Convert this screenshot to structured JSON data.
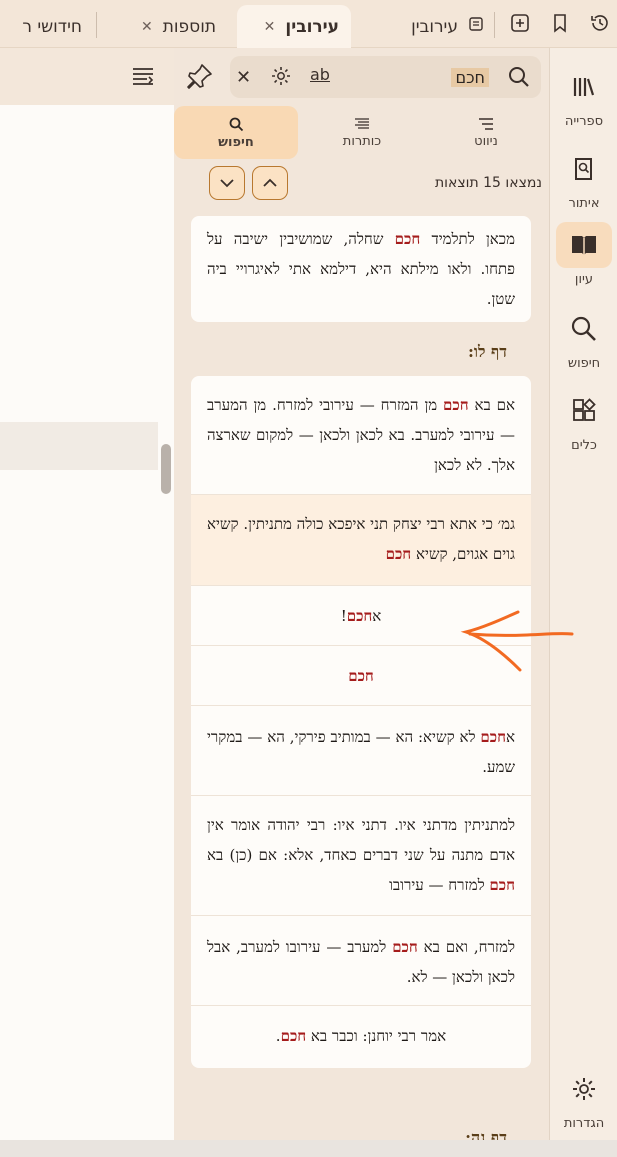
{
  "tabs": [
    {
      "label": "עירובין",
      "active": false,
      "closable": false
    },
    {
      "label": "עירובין",
      "active": true,
      "closable": true
    },
    {
      "label": "תוספות",
      "active": false,
      "closable": true
    },
    {
      "label": "חידושי ר",
      "active": false,
      "closable": true
    }
  ],
  "tab_icons": [
    "history-icon",
    "bookmark-icon",
    "add-tab-icon",
    "book-tab-icon"
  ],
  "rail": {
    "items": [
      {
        "label": "ספרייה",
        "icon": "library-icon"
      },
      {
        "label": "איתור",
        "icon": "locate-icon"
      },
      {
        "label": "עיון",
        "icon": "open-book-icon",
        "active": true
      },
      {
        "label": "חיפוש",
        "icon": "search-icon"
      },
      {
        "label": "כלים",
        "icon": "tools-icon"
      }
    ],
    "settings_label": "הגדרות"
  },
  "search": {
    "query": "חכם",
    "option_label": "ab"
  },
  "mode_tabs": [
    {
      "label": "ניווט",
      "icon": "nav-icon"
    },
    {
      "label": "כותרות",
      "icon": "headings-icon"
    },
    {
      "label": "חיפוש",
      "icon": "search-icon",
      "active": true
    }
  ],
  "results_count": "נמצאו 15 תוצאות",
  "results": {
    "card1": [
      [
        "מכאן לתלמיד ",
        {
          "m": "חכם"
        },
        " שחלה, שמושיבין ישיבה על פתחו. ולאו מילתא היא, דילמא אתי לאיגרויי ביה שטן."
      ]
    ],
    "daf_lu": "דף לו:",
    "card2": [
      [
        "אם בא ",
        {
          "m": "חכם"
        },
        " מן המזרח — עירובי למזרח. מן המערב — עירובי למערב. בא לכאן ולכאן — למקום שארצה אלך. לא לכאן"
      ],
      [
        "גמ׳ כי אתא רבי יצחק תני איפכא כולה מתניתין. קשיא גוים אגוים, קשיא ",
        {
          "m": "חכם"
        }
      ],
      [
        "א",
        {
          "m": "חכם"
        },
        "!"
      ],
      [
        {
          "m": "חכם"
        }
      ],
      [
        "א",
        {
          "m": "חכם"
        },
        " לא קשיא: הא — במותיב פירקי, הא — במקרי שמע."
      ],
      [
        "למתניתין מדתני איו. דתני איו: רבי יהודה אומר אין אדם מתנה על שני דברים כאחד, אלא: אם (כן) בא ",
        {
          "m": "חכם"
        },
        " למזרח — עירובו"
      ],
      [
        "למזרח, ואם בא ",
        {
          "m": "חכם"
        },
        " למערב — עירובו למערב, אבל לכאן ולכאן — לא."
      ],
      [
        "אמר רבי יוחנן: וכבר בא ",
        {
          "m": "חכם"
        },
        "."
      ]
    ],
    "daf_nh": "דף נה:"
  },
  "colors": {
    "highlight_text": "#a51c1c",
    "accent": "#f9d9b4",
    "annotation_arrow": "#f26a22"
  }
}
